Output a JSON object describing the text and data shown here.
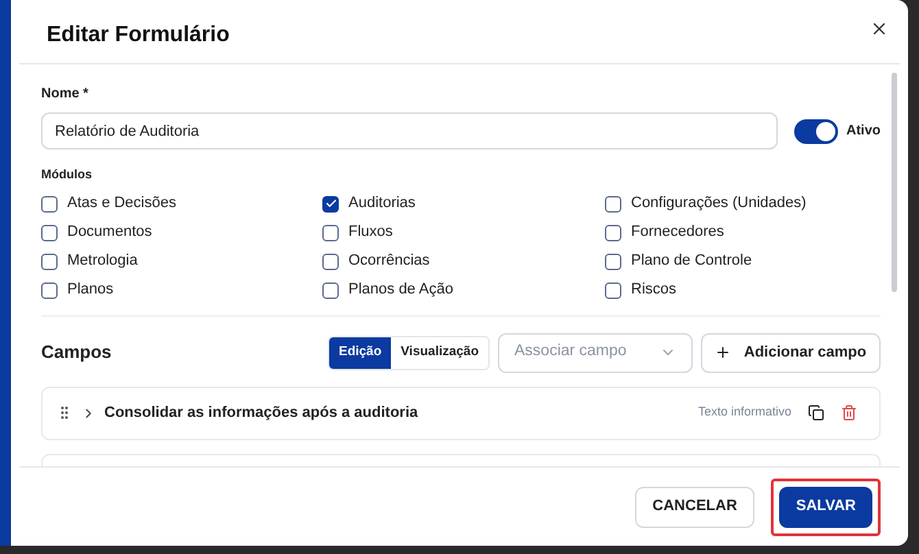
{
  "dialog": {
    "title": "Editar Formulário"
  },
  "name_field": {
    "label": "Nome *",
    "value": "Relatório de Auditoria"
  },
  "active_toggle": {
    "label": "Ativo",
    "on": true
  },
  "modules": {
    "label": "Módulos",
    "items": [
      {
        "label": "Atas e Decisões",
        "checked": false
      },
      {
        "label": "Auditorias",
        "checked": true
      },
      {
        "label": "Configurações (Unidades)",
        "checked": false
      },
      {
        "label": "Documentos",
        "checked": false
      },
      {
        "label": "Fluxos",
        "checked": false
      },
      {
        "label": "Fornecedores",
        "checked": false
      },
      {
        "label": "Metrologia",
        "checked": false
      },
      {
        "label": "Ocorrências",
        "checked": false
      },
      {
        "label": "Plano de Controle",
        "checked": false
      },
      {
        "label": "Planos",
        "checked": false
      },
      {
        "label": "Planos de Ação",
        "checked": false
      },
      {
        "label": "Riscos",
        "checked": false
      }
    ]
  },
  "fields": {
    "title": "Campos",
    "view_tabs": [
      {
        "label": "Edição",
        "selected": true
      },
      {
        "label": "Visualização",
        "selected": false
      }
    ],
    "associate_select": {
      "placeholder": "Associar campo"
    },
    "add_button": {
      "label": "Adicionar campo"
    },
    "rows": [
      {
        "title": "Consolidar as informações após a auditoria",
        "type": "Texto informativo",
        "expanded": false
      }
    ]
  },
  "footer": {
    "buttons": [
      {
        "label": "CANCELAR",
        "kind": "secondary",
        "highlighted": false
      },
      {
        "label": "SALVAR",
        "kind": "primary",
        "highlighted": true
      }
    ]
  }
}
